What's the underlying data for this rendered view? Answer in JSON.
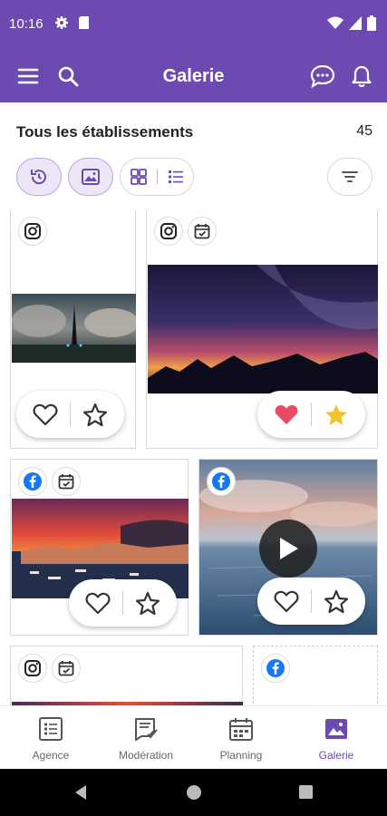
{
  "status_bar": {
    "time": "10:16"
  },
  "app_bar": {
    "title": "Galerie"
  },
  "header": {
    "title": "Tous les établissements",
    "count": "45"
  },
  "filters": [
    {
      "name": "history-icon",
      "selected": true
    },
    {
      "name": "image-icon",
      "selected": true
    },
    {
      "name": "grid-view-icon"
    },
    {
      "name": "list-view-icon"
    },
    {
      "name": "filter-icon"
    }
  ],
  "cards": [
    {
      "network": "instagram",
      "scheduled": false,
      "image": "dark obelisk landscape",
      "liked": false,
      "starred": false
    },
    {
      "network": "instagram",
      "scheduled": true,
      "image": "milky way over mountains",
      "liked": true,
      "starred": true
    },
    {
      "network": "facebook",
      "scheduled": true,
      "image": "coastal city at sunset",
      "liked": false,
      "starred": false
    },
    {
      "network": "facebook",
      "scheduled": false,
      "image": "sea under sunset sky",
      "video": true,
      "liked": false,
      "starred": false
    },
    {
      "network": "instagram",
      "scheduled": true,
      "image": "sunset"
    },
    {
      "network": "facebook",
      "scheduled": false,
      "placeholder": true
    }
  ],
  "bottom_nav": [
    {
      "label": "Agence",
      "icon": "list-icon"
    },
    {
      "label": "Modération",
      "icon": "moderation-icon"
    },
    {
      "label": "Planning",
      "icon": "calendar-icon"
    },
    {
      "label": "Galerie",
      "icon": "gallery-icon",
      "active": true
    }
  ],
  "colors": {
    "primary": "#6c4ab1",
    "heart": "#e84b63",
    "star": "#f2c12e",
    "facebook": "#1877f2"
  }
}
